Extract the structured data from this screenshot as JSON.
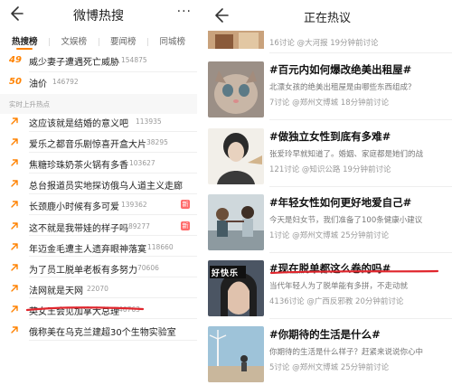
{
  "left": {
    "header": {
      "title": "微博热搜",
      "more": "···"
    },
    "tabs": [
      "热搜榜",
      "文娱榜",
      "要闻榜",
      "同城榜"
    ],
    "top_rows": [
      {
        "rank": "49",
        "title": "威少妻子遭遇死亡威胁",
        "count": "154875"
      },
      {
        "rank": "50",
        "title": "油价",
        "count": "146792"
      }
    ],
    "section_label": "实时上升热点",
    "rising": [
      {
        "title": "这应该就是结婚的意义吧",
        "count": "113935",
        "badge": ""
      },
      {
        "title": "爱乐之都音乐剧惊喜开盒大片",
        "count": "38295",
        "badge": ""
      },
      {
        "title": "焦糖珍珠奶茶火锅有多香",
        "count": "103627",
        "badge": ""
      },
      {
        "title": "总台报道员实地探访俄乌人道主义走廊",
        "count": "",
        "badge": ""
      },
      {
        "title": "长颈鹿小时候有多可爱",
        "count": "139362",
        "badge": "新"
      },
      {
        "title": "这不就是我带娃的样子吗",
        "count": "89277",
        "badge": "新"
      },
      {
        "title": "年迈金毛遭主人遗弃眼神落寞",
        "count": "118660",
        "badge": ""
      },
      {
        "title": "为了员工脱单老板有多努力",
        "count": "70606",
        "badge": ""
      },
      {
        "title": "法网就是天网",
        "count": "22070",
        "badge": ""
      },
      {
        "title": "英女王会见加拿大总理",
        "count": "46763",
        "badge": ""
      },
      {
        "title": "俄称美在乌克兰建超30个生物实验室",
        "count": "",
        "badge": ""
      }
    ],
    "colors": {
      "accent": "#ff8200",
      "underline": "#e0262d"
    }
  },
  "right": {
    "header": {
      "title": "正在热议"
    },
    "top_meta": "16讨论  @大河报 19分钟前讨论",
    "topics": [
      {
        "title": "#百元内如何爆改绝美出租屋#",
        "desc": "北漂女孩的绝美出租屋是由哪些东西组成？",
        "meta": "7讨论  @郑州文博城 18分钟前讨论"
      },
      {
        "title": "#做独立女性到底有多难#",
        "desc": "张爱玲早就知道了。婚姻、家庭都是她们的战",
        "meta": "121讨论  @知识公路 19分钟前讨论"
      },
      {
        "title": "#年轻女性如何更好地爱自己#",
        "desc": "今天是妇女节，我们准备了100条健康小建议",
        "meta": "1讨论  @郑州文博城 25分钟前讨论"
      },
      {
        "title": "#现在脱单都这么卷的吗#",
        "desc": "当代年轻人为了脱单能有多拼，不走动就",
        "meta": "4136讨论  @广西反邪教 20分钟前讨论"
      },
      {
        "title": "#你期待的生活是什么#",
        "desc": "你期待的生活是什么样子？赶紧来说说你心中",
        "meta": "5讨论  @郑州文博城 25分钟前讨论"
      }
    ],
    "thumb_caption": "好快乐"
  }
}
